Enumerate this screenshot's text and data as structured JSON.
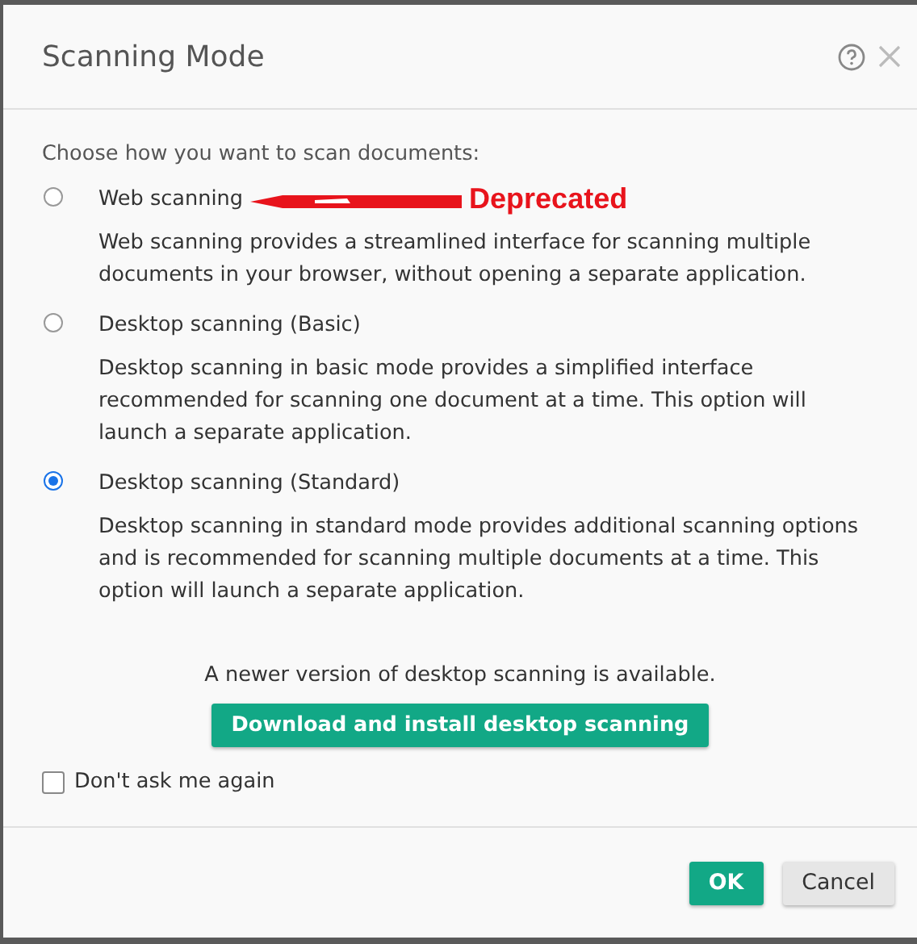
{
  "dialog": {
    "title": "Scanning Mode"
  },
  "intro": "Choose how you want to scan documents:",
  "options": [
    {
      "label": "Web scanning",
      "description": "Web scanning provides a streamlined interface for scanning multiple documents in your browser, without opening a separate application.",
      "selected": false,
      "annotation": "Deprecated"
    },
    {
      "label": "Desktop scanning (Basic)",
      "description": "Desktop scanning in basic mode provides a simplified interface recommended for scanning one document at a time. This option will launch a separate application.",
      "selected": false
    },
    {
      "label": "Desktop scanning (Standard)",
      "description": "Desktop scanning in standard mode provides additional scanning options and is recommended for scanning multiple documents at a time. This option will launch a separate application.",
      "selected": true
    }
  ],
  "update_notice": "A newer version of desktop scanning is available.",
  "download_button": "Download and install desktop scanning",
  "dont_ask": {
    "label": "Don't ask me again",
    "checked": false
  },
  "buttons": [
    {
      "label": "OK",
      "kind": "primary"
    },
    {
      "label": "Cancel",
      "kind": "secondary"
    }
  ]
}
